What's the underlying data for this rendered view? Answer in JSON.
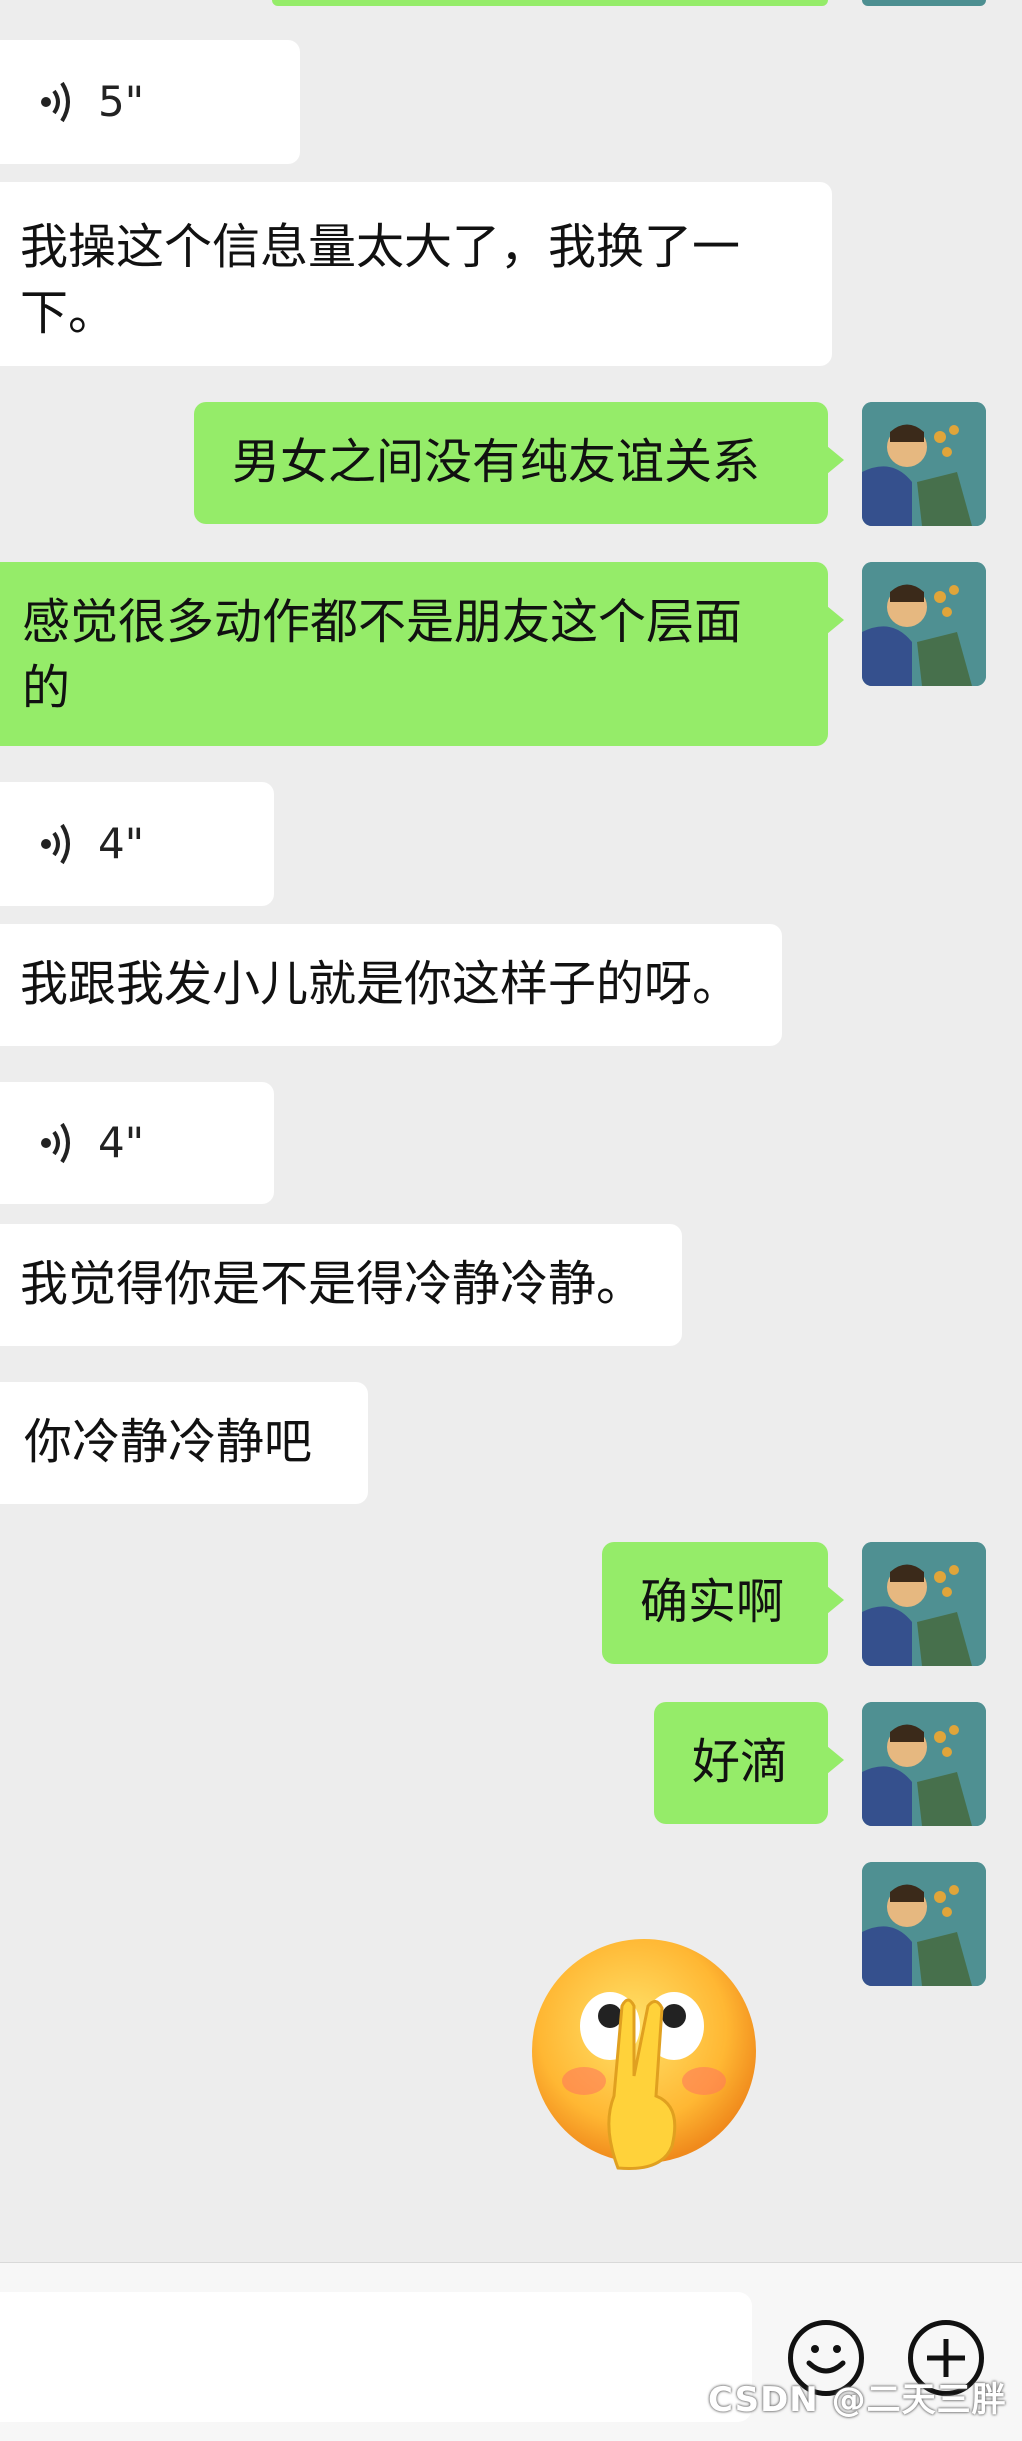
{
  "messages": [
    {
      "id": "m1",
      "side": "in",
      "type": "voice",
      "duration": "5\""
    },
    {
      "id": "m2",
      "side": "in",
      "type": "text",
      "lines": [
        "我操这个信息量太大了，我换了一",
        "下。"
      ]
    },
    {
      "id": "m3",
      "side": "out",
      "type": "text",
      "lines": [
        "男女之间没有纯友谊关系"
      ]
    },
    {
      "id": "m4",
      "side": "out",
      "type": "text",
      "lines": [
        "感觉很多动作都不是朋友这个层面",
        "的"
      ]
    },
    {
      "id": "m5",
      "side": "in",
      "type": "voice",
      "duration": "4\""
    },
    {
      "id": "m6",
      "side": "in",
      "type": "text",
      "lines": [
        "我跟我发小儿就是你这样子的呀。"
      ]
    },
    {
      "id": "m7",
      "side": "in",
      "type": "voice",
      "duration": "4\""
    },
    {
      "id": "m8",
      "side": "in",
      "type": "text",
      "lines": [
        "我觉得你是不是得冷静冷静。"
      ]
    },
    {
      "id": "m9",
      "side": "in",
      "type": "text",
      "lines": [
        "你冷静冷静吧"
      ]
    },
    {
      "id": "m10",
      "side": "out",
      "type": "text",
      "lines": [
        "确实啊"
      ]
    },
    {
      "id": "m11",
      "side": "out",
      "type": "text",
      "lines": [
        "好滴"
      ]
    },
    {
      "id": "m12",
      "side": "out",
      "type": "sticker",
      "sticker": "peace-sign-emoji"
    }
  ],
  "input_bar": {
    "emoji_icon": "smiley-icon",
    "more_icon": "plus-icon"
  },
  "watermark": "CSDN @二天三胖",
  "colors": {
    "background": "#ededed",
    "incoming": "#ffffff",
    "outgoing": "#95ec69"
  }
}
